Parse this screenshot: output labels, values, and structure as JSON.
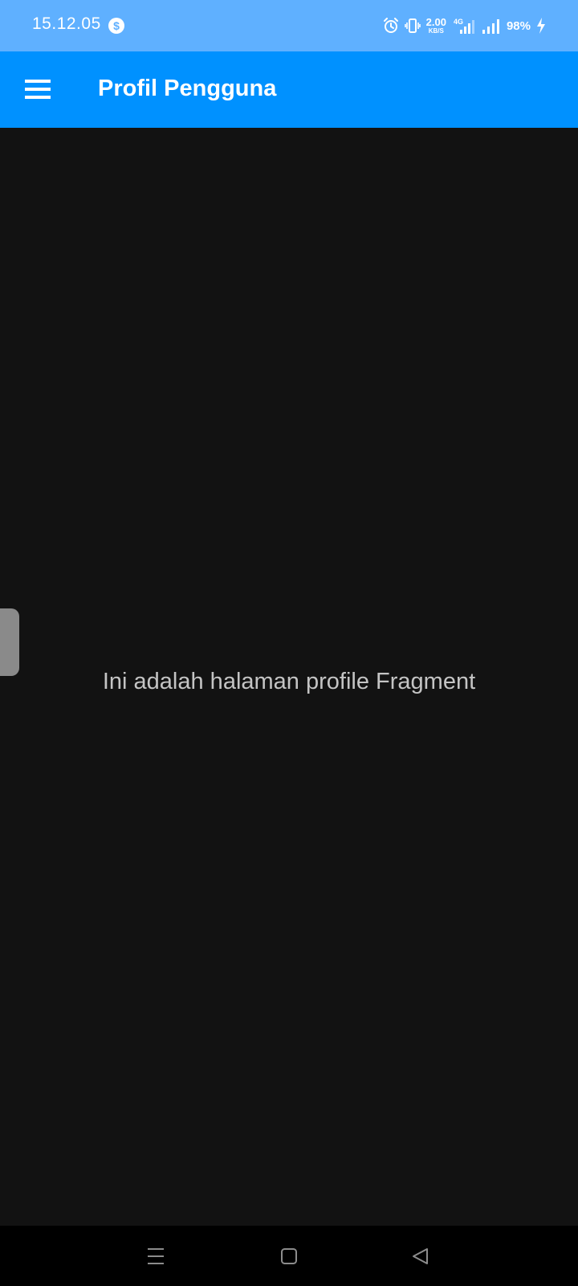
{
  "status_bar": {
    "time": "15.12.05",
    "app_icon_glyph": "$",
    "net_speed_value": "2.00",
    "net_speed_unit": "KB/S",
    "network_type": "4G",
    "battery": "98%",
    "icons": [
      "alarm-icon",
      "vibrate-icon",
      "signal-4g-icon",
      "signal-icon",
      "charging-icon"
    ]
  },
  "app_bar": {
    "title": "Profil Pengguna",
    "menu_icon": "hamburger-menu-icon"
  },
  "content": {
    "message": "Ini adalah halaman profile Fragment"
  },
  "nav_bar": {
    "icons": [
      "recents-icon",
      "home-icon",
      "back-icon"
    ]
  },
  "colors": {
    "status_bar_bg": "#5fb0ff",
    "app_bar_bg": "#0091ff",
    "content_bg": "#121212",
    "message_text": "#c4c4c4",
    "nav_bar_bg": "#000000"
  }
}
